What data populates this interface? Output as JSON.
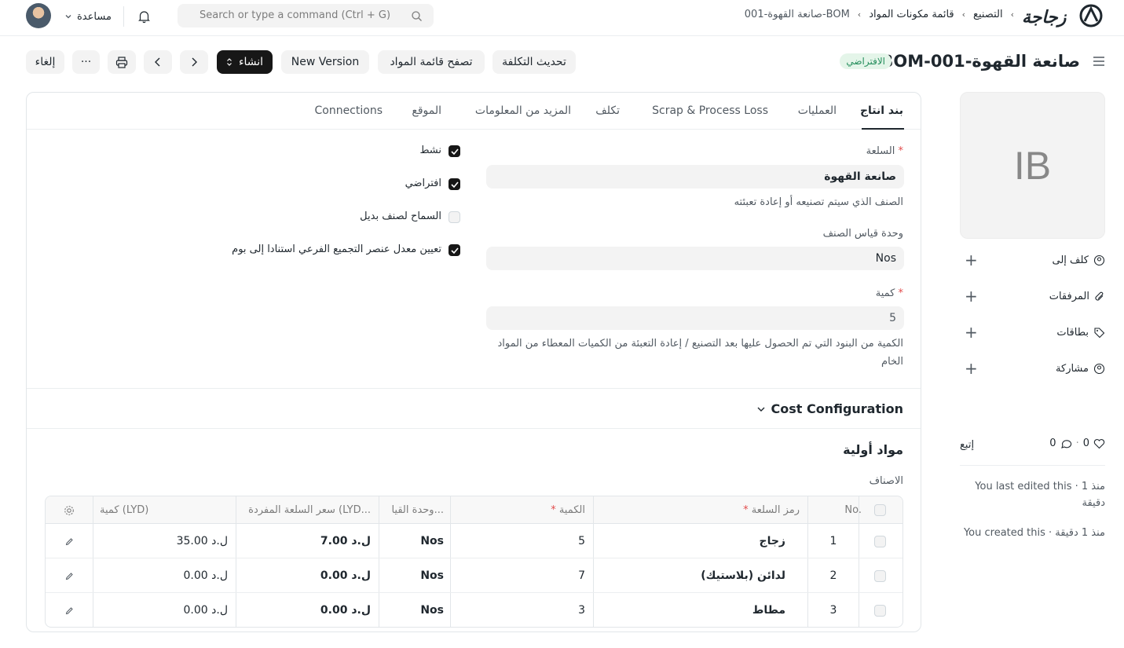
{
  "navbar": {
    "help_label": "مساعدة",
    "search_placeholder": "Search or type a command (Ctrl + G)",
    "breadcrumb": [
      "التصنيع",
      "قائمة مكونات المواد",
      "BOM-صانعة القهوة-001"
    ],
    "logo_text": "زجاجة"
  },
  "page": {
    "title": "BOM-صانعة القهوة-001",
    "status_badge": "الافتراضي"
  },
  "toolbar": {
    "cancel": "إلغاء",
    "more": "···",
    "create": "انشاء",
    "new_version": "New Version",
    "browse_bom": "تصفح قائمة المواد",
    "update_cost": "تحديث التكلفة"
  },
  "tabs": [
    "بند انتاج",
    "العمليات",
    "Scrap & Process Loss",
    "تكلف",
    "المزيد من المعلومات",
    "الموقع",
    "Connections"
  ],
  "form": {
    "item_label": "السلعة",
    "item_value": "صانعة القهوة",
    "item_desc": "الصنف الذي سيتم تصنيعه أو إعادة تعبئته",
    "uom_label": "وحدة قياس الصنف",
    "uom_value": "Nos",
    "qty_label": "كمية",
    "qty_value": "5",
    "qty_desc": "الكمية من البنود التي تم الحصول عليها بعد التصنيع / إعادة التعبئة من الكميات المعطاء من المواد الخام",
    "checks": [
      {
        "label": "نشط",
        "checked": true
      },
      {
        "label": "افتراضي",
        "checked": true
      },
      {
        "label": "السماح لصنف بديل",
        "checked": false
      },
      {
        "label": "تعيين معدل عنصر التجميع الفرعي استنادا إلى بوم",
        "checked": true
      }
    ]
  },
  "cost_section": "Cost Configuration",
  "raw_materials": {
    "title": "مواد أولية",
    "items_label": "الاصناف",
    "headers": {
      "no": "No.",
      "item_code": "رمز السلعة",
      "qty": "الكمية",
      "uom": "وحدة القيا...",
      "rate": "سعر السلعة المفردة (LYD...",
      "amount": "كمية (LYD)"
    },
    "rows": [
      {
        "no": "1",
        "item_code": "زجاج",
        "qty": "5",
        "uom": "Nos",
        "rate": "ل.د 7.00",
        "amount": "ل.د 35.00"
      },
      {
        "no": "2",
        "item_code": "لدائن (بلاستيك)",
        "qty": "7",
        "uom": "Nos",
        "rate": "ل.د 0.00",
        "amount": "ل.د 0.00"
      },
      {
        "no": "3",
        "item_code": "مطاط",
        "qty": "3",
        "uom": "Nos",
        "rate": "ل.د 0.00",
        "amount": "ل.د 0.00"
      }
    ]
  },
  "sidebar": {
    "avatar_initials": "IB",
    "assign_to": "كلف إلى",
    "attachments": "المرفقات",
    "tags": "بطاقات",
    "share": "مشاركة",
    "likes": "0",
    "comments": "0",
    "follow": "إتبع",
    "last_edited": "You last edited this · منذ 1 دقيقة",
    "created": "You created this · منذ 1 دقيقة"
  },
  "colors": {
    "primary_dark": "#171717",
    "badge_green": "#278f5e",
    "required": "#e24c4c"
  }
}
